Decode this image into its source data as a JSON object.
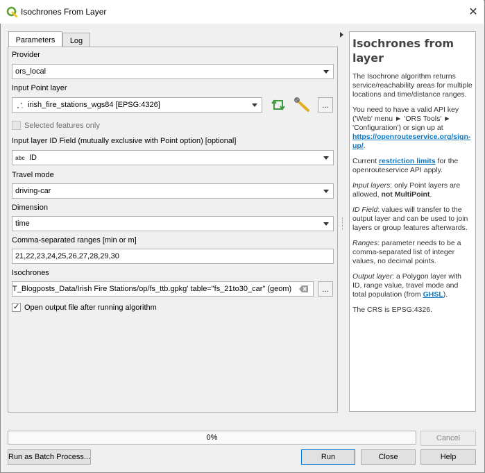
{
  "window": {
    "title": "Isochrones From Layer",
    "close_glyph": "✕"
  },
  "tabs": [
    {
      "label": "Parameters"
    },
    {
      "label": "Log"
    }
  ],
  "form": {
    "provider": {
      "label": "Provider",
      "value": "ors_local"
    },
    "input_point_layer": {
      "label": "Input Point layer",
      "value": "irish_fire_stations_wgs84 [EPSG:4326]",
      "more_label": "..."
    },
    "selected_features_only": {
      "label": "Selected features only",
      "checked": false,
      "enabled": false
    },
    "id_field": {
      "label": "Input layer ID Field (mutually exclusive with Point option) [optional]",
      "type_badge": "abc",
      "value": "ID"
    },
    "travel_mode": {
      "label": "Travel mode",
      "value": "driving-car"
    },
    "dimension": {
      "label": "Dimension",
      "value": "time"
    },
    "ranges": {
      "label": "Comma-separated ranges [min or m]",
      "value": "21,22,23,24,25,26,27,28,29,30"
    },
    "isochrones": {
      "label": "Isochrones",
      "value": "T_Blogposts_Data/Irish Fire Stations/op/fs_ttb.gpkg' table=\"fs_21to30_car\" (geom)",
      "more_label": "..."
    },
    "open_output": {
      "label": "Open output file after running algorithm",
      "checked": true,
      "check_glyph": "✓"
    }
  },
  "help": {
    "title": "Isochrones from layer",
    "p1": "The Isochrone algorithm returns service/reachability areas for multiple locations and time/distance ranges.",
    "p2_pre": "You need to have a valid API key ('Web' menu ► 'ORS Tools' ► 'Configuration') or sign up at ",
    "p2_link": "https://openrouteservice.org/sign-up/",
    "p2_post": ".",
    "p3_pre": "Current ",
    "p3_link": "restriction limits",
    "p3_post": " for the openrouteservice API apply.",
    "p4_em": "Input layers",
    "p4_mid": ": only Point layers are allowed, ",
    "p4_bold": "not MultiPoint",
    "p4_post": ".",
    "p5_em": "ID Field",
    "p5_post": ": values will transfer to the output layer and can be used to join layers or group features afterwards.",
    "p6_em": "Ranges",
    "p6_post": ": parameter needs to be a comma-separated list of integer values, no decimal points.",
    "p7_em": "Output layer",
    "p7_mid": ": a Polygon layer with ID, range value, travel mode and total population (from ",
    "p7_link": "GHSL",
    "p7_post": ").",
    "p8": "The CRS is EPSG:4326."
  },
  "progress": {
    "text": "0%",
    "value": 0
  },
  "buttons": {
    "cancel": "Cancel",
    "batch": "Run as Batch Process...",
    "run": "Run",
    "close": "Close",
    "help": "Help"
  },
  "colors": {
    "link": "#0b78c2",
    "qgis_green": "#5a9e30",
    "qgis_yellow": "#efc420"
  }
}
